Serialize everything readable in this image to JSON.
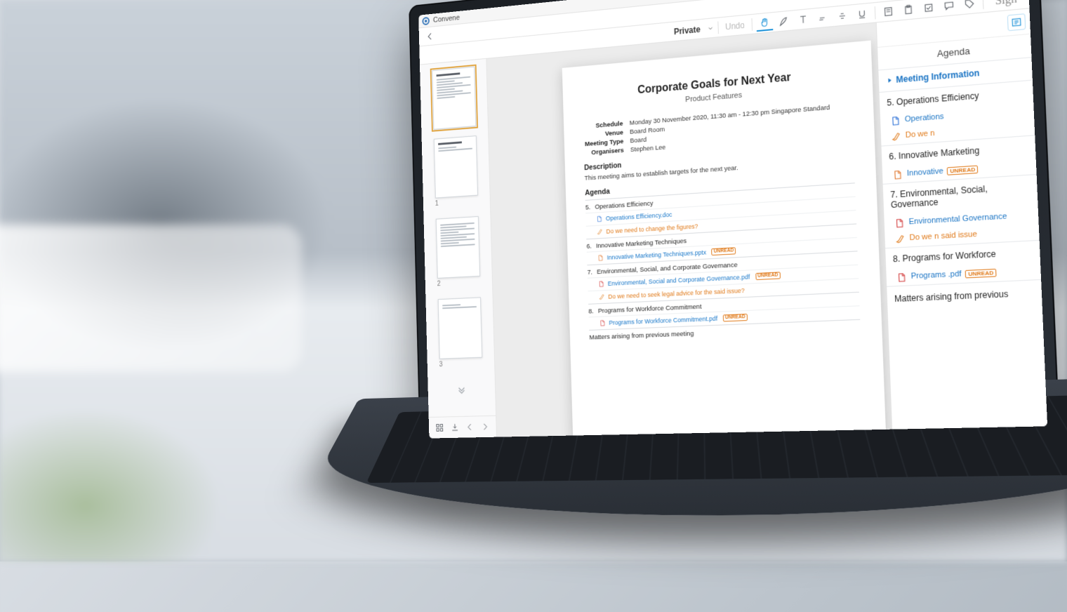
{
  "app": {
    "name": "Convene"
  },
  "toolbar": {
    "private_label": "Private",
    "undo_label": "Undo",
    "sign_label": "Sign"
  },
  "thumbnails": [
    {
      "num": "",
      "selected": true
    },
    {
      "num": "1",
      "selected": false
    },
    {
      "num": "2",
      "selected": false
    },
    {
      "num": "3",
      "selected": false
    }
  ],
  "document": {
    "title": "Corporate Goals for Next Year",
    "subtitle": "Product Features",
    "meta": {
      "schedule_label": "Schedule",
      "schedule": "Monday 30 November 2020, 11:30 am - 12:30 pm Singapore Standard",
      "venue_label": "Venue",
      "venue": "Board Room",
      "type_label": "Meeting Type",
      "type": "Board",
      "organisers_label": "Organisers",
      "organisers": "Stephen Lee"
    },
    "description_label": "Description",
    "description": "This meeting aims to establish targets for the next year.",
    "agenda_label": "Agenda",
    "items": [
      {
        "num": "5.",
        "title": "Operations Efficiency",
        "attachments": [
          {
            "kind": "doc",
            "text": "Operations Efficiency.doc"
          },
          {
            "kind": "question",
            "text": "Do we need to change the figures?"
          }
        ]
      },
      {
        "num": "6.",
        "title": "Innovative Marketing Techniques",
        "attachments": [
          {
            "kind": "ppt",
            "text": "Innovative Marketing Techniques.pptx",
            "unread": true
          }
        ]
      },
      {
        "num": "7.",
        "title": "Environmental, Social, and Corporate Governance",
        "attachments": [
          {
            "kind": "pdf",
            "text": "Environmental, Social and Corporate Governance.pdf",
            "unread": true
          },
          {
            "kind": "question",
            "text": "Do we need to seek legal advice for the said issue?"
          }
        ]
      },
      {
        "num": "8.",
        "title": "Programs for Workforce Commitment",
        "attachments": [
          {
            "kind": "pdf",
            "text": "Programs for Workforce Commitment.pdf",
            "unread": true
          }
        ]
      }
    ],
    "matters": "Matters arising from previous meeting"
  },
  "agenda_panel": {
    "title": "Agenda",
    "meeting_info": "Meeting Information",
    "sections": [
      {
        "num": "5.",
        "title": "Operations Efficiency",
        "lines": [
          {
            "kind": "doc",
            "text": "Operations"
          },
          {
            "kind": "question",
            "text": "Do we n"
          }
        ]
      },
      {
        "num": "6.",
        "title": "Innovative Marketing",
        "lines": [
          {
            "kind": "ppt",
            "text": "Innovative",
            "unread": true
          }
        ]
      },
      {
        "num": "7.",
        "title": "Environmental, Social, Governance",
        "lines": [
          {
            "kind": "pdf",
            "text": "Environmental Governance"
          },
          {
            "kind": "question",
            "text": "Do we n said issue"
          }
        ]
      },
      {
        "num": "8.",
        "title": "Programs for Workforce",
        "lines": [
          {
            "kind": "pdf",
            "text": "Programs .pdf",
            "unread": true
          }
        ]
      }
    ],
    "matters": "Matters arising from previous"
  },
  "badges": {
    "unread": "UNREAD"
  }
}
